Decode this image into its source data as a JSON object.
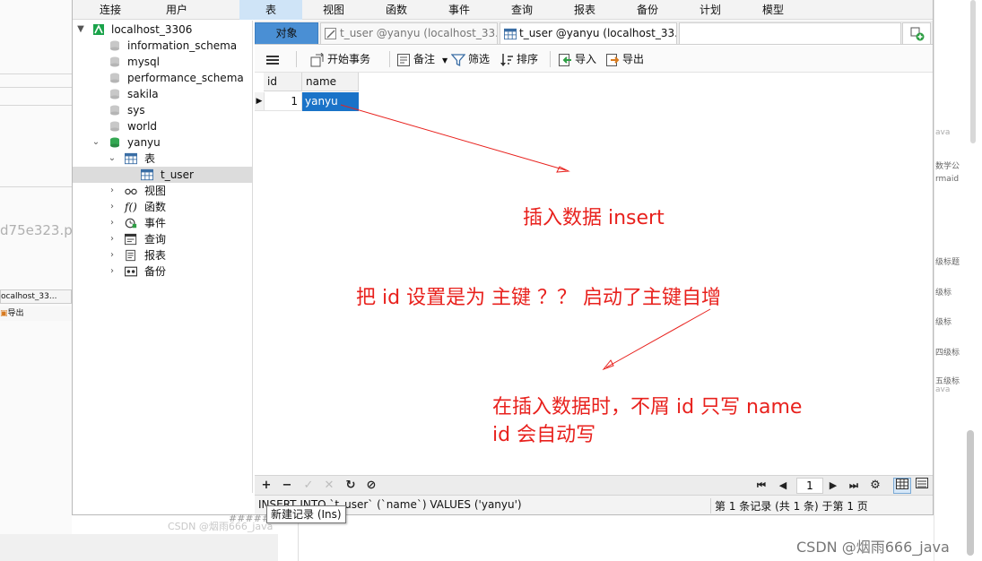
{
  "menu": {
    "items": [
      "连接",
      "用户",
      "表",
      "视图",
      "函数",
      "事件",
      "查询",
      "报表",
      "备份",
      "计划",
      "模型"
    ],
    "active_index": 2
  },
  "sidebar": {
    "connection": "localhost_3306",
    "databases": [
      "information_schema",
      "mysql",
      "performance_schema",
      "sakila",
      "sys",
      "world",
      "yanyu"
    ],
    "yanyu_children": [
      "表",
      "视图",
      "函数",
      "事件",
      "查询",
      "报表",
      "备份"
    ],
    "table_item": "t_user"
  },
  "tabs": {
    "objects_label": "对象",
    "tab1_label": "t_user @yanyu (localhost_33...",
    "tab2_label": "t_user @yanyu (localhost_33..."
  },
  "toolbar": {
    "begin_transaction": "开始事务",
    "memo": "备注",
    "filter": "筛选",
    "sort": "排序",
    "import": "导入",
    "export": "导出"
  },
  "grid": {
    "columns": [
      "id",
      "name"
    ],
    "rows": [
      {
        "id": "1",
        "name": "yanyu"
      }
    ]
  },
  "annotations": {
    "line1": "插入数据    insert",
    "line2": "把  id  设置是为   主键  ？？   启动了主键自增",
    "line3": "在插入数据时，不屑  id   只写    name",
    "line4": "id  会自动写"
  },
  "navbar": {
    "page": "1"
  },
  "status": {
    "sql": "INSERT INTO `t_user` (`name`) VALUES ('yanyu')",
    "record": "第 1 条记录 (共 1 条) 于第 1 页"
  },
  "tooltip": "新建记录 (Ins)",
  "background": {
    "hash_fragment": "d75e323.p",
    "tab_fragment": "ocalhost_33...",
    "export_fragment": "导出",
    "right_texts": [
      "ava",
      "数学公",
      "rmaid",
      "级标题",
      "级标",
      "级标",
      "四级标",
      "五级标",
      "ava"
    ],
    "csdn_small": "CSDN @烟雨666_java",
    "hidden_prefix": "##### 五"
  },
  "watermark": "CSDN @烟雨666_java",
  "colors": {
    "accent": "#4a8fd4",
    "selected_cell": "#1a73c8",
    "annotation": "#e8211d",
    "menu_active": "#cfe4f7"
  }
}
